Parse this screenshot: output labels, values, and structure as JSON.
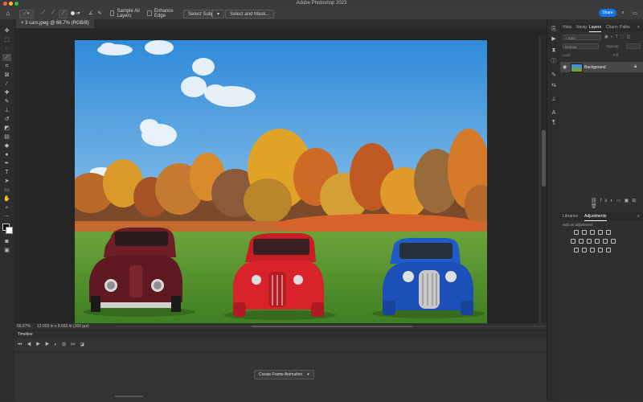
{
  "app": {
    "title": "Adobe Photoshop 2023"
  },
  "options_bar": {
    "sample_all_layers": "Sample All Layers",
    "enhance_edge": "Enhance Edge",
    "select_subject": "Select Subject",
    "select_and_mask": "Select and Mask...",
    "share": "Share",
    "brush_size": "5"
  },
  "document": {
    "tab_label": "3 cars.jpeg @ 66.7% (RGB/8)",
    "zoom": "66.67%",
    "info": "12.003 in x 8.693 in (300 ppi)"
  },
  "timeline": {
    "title": "Timeline",
    "create_button": "Create Frame Animation"
  },
  "panels": {
    "tabs_top": [
      "Histo",
      "Navig",
      "Layers",
      "Chann",
      "Paths"
    ],
    "active_top": "Layers",
    "kind_placeholder": "Kind",
    "blend_mode": "Normal",
    "opacity_label": "Opacity:",
    "lock_label": "Lock:",
    "fill_label": "Fill:",
    "layer_name": "Background",
    "tabs_bottom": [
      "Libraries",
      "Adjustments"
    ],
    "active_bottom": "Adjustments",
    "add_adjustment": "Add an adjustment"
  },
  "colors": {
    "accent": "#1473e6",
    "red_car": "#d8232a",
    "blue_car": "#1d4fb8",
    "maroon_car": "#6e1f26"
  }
}
